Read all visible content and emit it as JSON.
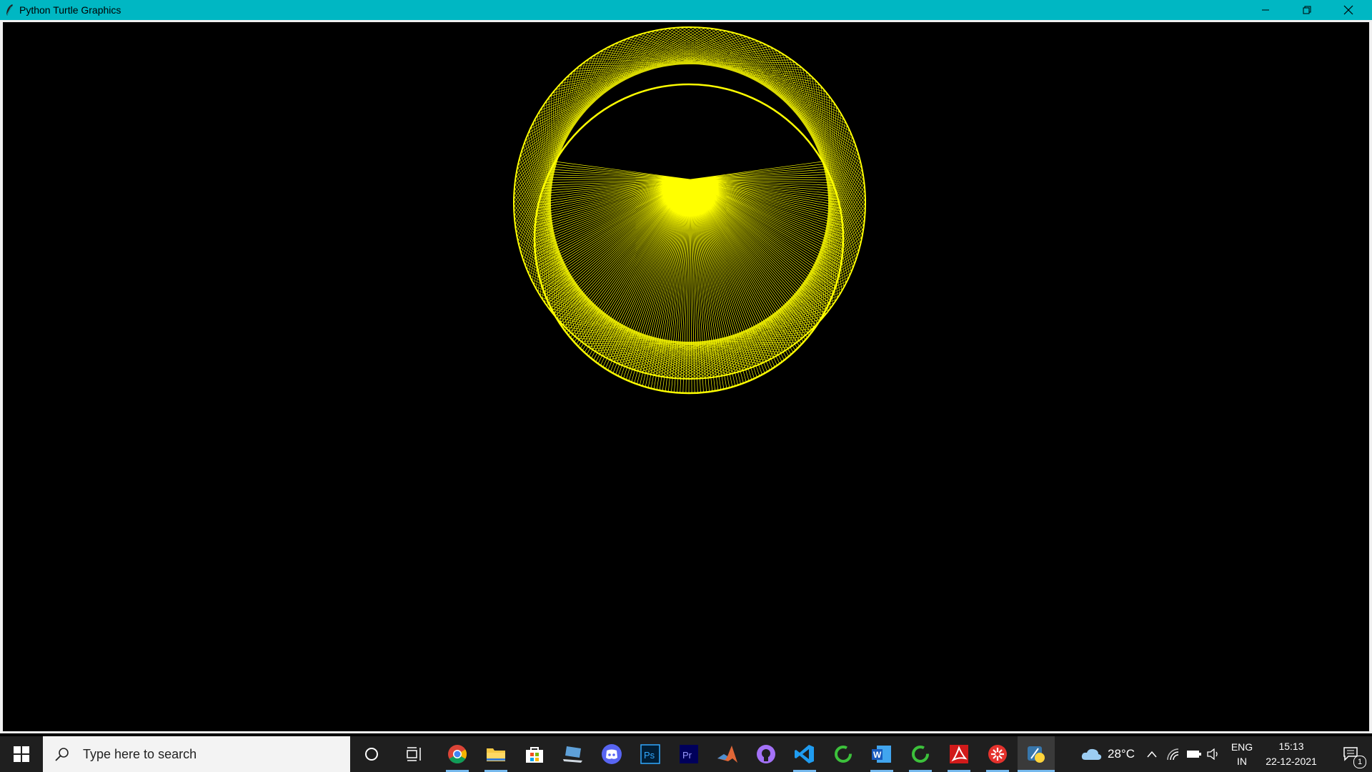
{
  "window": {
    "title": "Python Turtle Graphics",
    "colors": {
      "titlebar": "#00b7c3",
      "canvas": "#000000",
      "drawing": "#ffff00"
    },
    "controls": [
      "minimize-icon",
      "restore-icon",
      "close-icon"
    ]
  },
  "taskbar": {
    "search_placeholder": "Type here to search",
    "pinned_apps": [
      "chrome",
      "file-explorer",
      "microsoft-store",
      "remote-desktop",
      "discord",
      "photoshop",
      "premiere-pro",
      "matlab",
      "github-desktop",
      "visual-studio-code",
      "green-ring-app",
      "word",
      "green-ring-app-2",
      "acrobat-reader",
      "red-flower-app",
      "python-turtle"
    ],
    "weather": {
      "temperature": "28°C"
    },
    "language": {
      "lang": "ENG",
      "region": "IN"
    },
    "clock": {
      "time": "15:13",
      "date": "22-12-2021"
    },
    "notifications": {
      "count": "1"
    }
  }
}
